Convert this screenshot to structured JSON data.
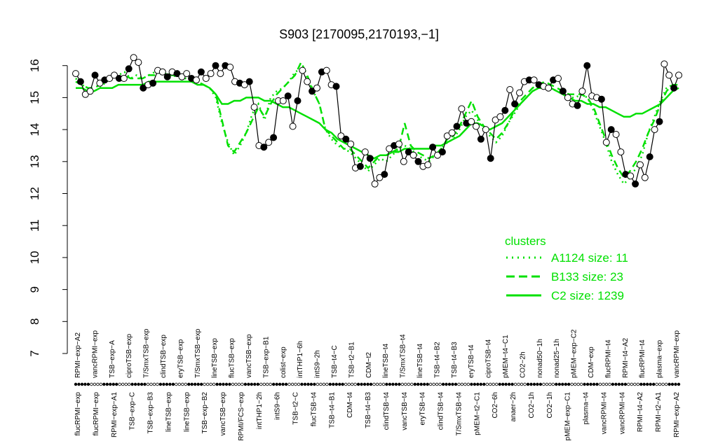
{
  "chart_data": {
    "type": "line",
    "title": "S903 [2170095,2170193,−1]",
    "ylim": [
      7,
      16.3
    ],
    "y_ticks": [
      "7",
      "8",
      "9",
      "10",
      "11",
      "12",
      "13",
      "14",
      "15",
      "16"
    ],
    "top_labels": [
      "RPMI−exp−A2",
      "vancRPMI−exp",
      "TSB−exp−A",
      "ciproTSB−exp",
      "T/SmxTSB−exp",
      "clindTSB−exp",
      "eryTSB−exp",
      "T/SmxTSB−exp",
      "lineTSB−exp",
      "flucTSB−exp",
      "vancTSB−exp",
      "TSB−exp−B1",
      "colist−exp",
      "intTHP1−6h",
      "intS9−2h",
      "TSB−t4−C",
      "TSB−t2−B1",
      "CDM−t2",
      "lineTSB−t4",
      "T/SmxTSB−t4",
      "lineTSB−t4",
      "TSB−t4−B2",
      "TSB−t4−B3",
      "eryTSB−t4",
      "ciproTSB−t4",
      "pMEM−t4−C1",
      "CO2−2h",
      "nonad50−1h",
      "nonad25−1h",
      "pMEM−exp−C2",
      "CDM−exp",
      "flucRPMI−t4",
      "RPMI−t4−A2",
      "flucRPMI−t4",
      "plasma−exp",
      "vancRPMI−exp"
    ],
    "bottom_labels": [
      "flucRPMI−exp",
      "flucRPMI−exp",
      "RPMI−exp−A1",
      "TSB−exp−C",
      "TSB−exp−B3",
      "lineTSB−exp",
      "lineTSB−exp",
      "TSB−exp−B2",
      "vancTSB−exp",
      "RPMI/FCS−exp",
      "intTHP1−2h",
      "intS9−6h",
      "TSB−t2−C",
      "flucTSB−t4",
      "TSB−t4−B1",
      "CDM−t4",
      "TSB−t4−B3",
      "clindTSB−t4",
      "vancTSB−t4",
      "eryTSB−t4",
      "clindTSB−t4",
      "T/SmxTSB−t4",
      "pMEM−t2−C1",
      "CO2−6h",
      "anaer−2h",
      "CO2−1h",
      "CO2−1h",
      "pMEM−exp−C1",
      "plasma−t4",
      "vancRPMI−t4",
      "vancRPMI−t4",
      "RPMI−t4−A2",
      "RPMI−t2−A1",
      "RPMI−exp−A2"
    ],
    "x_count": 193,
    "series": [
      {
        "name": "A1124 size: 11",
        "values": [
          15.6,
          15.4,
          15.3,
          15.2,
          15.3,
          15.5,
          15.6,
          15.7,
          15.8,
          15.6,
          15.7,
          15.6,
          15.7,
          15.8,
          15.9,
          15.7,
          15.8,
          15.6,
          15.7,
          15.6,
          15.5,
          15.4,
          15.3,
          15.0,
          14.2,
          13.6,
          13.2,
          13.5,
          13.9,
          14.5,
          14.8,
          14.3,
          15.0,
          15.2,
          15.3,
          15.5,
          15.8,
          15.9,
          15.6,
          15.2,
          14.8,
          14.0,
          13.7,
          13.5,
          13.4,
          13.3,
          13.1,
          12.9,
          12.7,
          12.9,
          13.1,
          13.0,
          13.2,
          13.4,
          13.5,
          13.4,
          13.2,
          13.1,
          13.0,
          13.2,
          13.4,
          13.6,
          13.7,
          14.0,
          14.4,
          14.6,
          14.3,
          14.0,
          13.8,
          13.6,
          13.8,
          14.2,
          14.5,
          14.8,
          15.0,
          15.2,
          15.3,
          15.4,
          15.3,
          15.2,
          15.1,
          15.0,
          15.0,
          15.1,
          15.0,
          14.6,
          14.1,
          13.6,
          13.0,
          12.6,
          12.3,
          12.5,
          12.8,
          13.2,
          13.9,
          14.4,
          14.9,
          15.3,
          15.4,
          15.4
        ],
        "color": "#00e000"
      },
      {
        "name": "B133 size: 23",
        "values": [
          15.5,
          15.4,
          15.3,
          15.3,
          15.4,
          15.5,
          15.6,
          15.6,
          15.7,
          15.6,
          15.6,
          15.6,
          15.7,
          15.7,
          15.8,
          15.7,
          15.7,
          15.6,
          15.6,
          15.5,
          15.5,
          15.4,
          15.3,
          15.1,
          14.3,
          13.5,
          13.3,
          13.6,
          13.9,
          14.3,
          14.7,
          14.4,
          14.8,
          15.1,
          15.3,
          15.5,
          15.7,
          16.1,
          15.7,
          15.2,
          14.8,
          14.0,
          13.8,
          13.6,
          13.4,
          13.4,
          13.2,
          13.0,
          12.8,
          13.0,
          13.2,
          13.2,
          13.3,
          13.4,
          14.2,
          13.5,
          13.3,
          13.2,
          13.1,
          13.2,
          13.4,
          13.7,
          13.8,
          14.1,
          14.5,
          14.9,
          14.4,
          14.1,
          13.9,
          13.7,
          13.9,
          14.2,
          14.6,
          14.9,
          15.1,
          15.3,
          15.4,
          15.5,
          15.4,
          15.3,
          15.2,
          15.1,
          15.1,
          15.1,
          15.0,
          14.7,
          14.2,
          13.7,
          13.2,
          12.8,
          12.5,
          12.7,
          13.0,
          13.4,
          13.9,
          14.3,
          14.8,
          15.2,
          15.4,
          15.4
        ],
        "color": "#00e000"
      },
      {
        "name": "C2 size: 1239",
        "values": [
          15.3,
          15.3,
          15.2,
          15.2,
          15.3,
          15.3,
          15.3,
          15.4,
          15.4,
          15.4,
          15.4,
          15.4,
          15.5,
          15.5,
          15.5,
          15.5,
          15.5,
          15.5,
          15.5,
          15.5,
          15.4,
          15.4,
          15.3,
          15.1,
          14.8,
          14.8,
          14.9,
          14.9,
          15.0,
          15.0,
          15.0,
          14.9,
          14.9,
          14.8,
          14.7,
          14.7,
          14.6,
          14.5,
          14.4,
          14.3,
          14.2,
          14.0,
          13.9,
          13.7,
          13.6,
          13.5,
          13.4,
          13.3,
          13.2,
          13.1,
          13.2,
          13.2,
          13.3,
          13.3,
          13.4,
          13.4,
          13.4,
          13.4,
          13.4,
          13.5,
          13.5,
          13.6,
          13.7,
          13.8,
          14.0,
          14.2,
          14.2,
          14.1,
          14.0,
          14.1,
          14.2,
          14.4,
          14.6,
          14.8,
          15.0,
          15.2,
          15.3,
          15.3,
          15.3,
          15.2,
          15.1,
          15.0,
          14.9,
          14.9,
          14.8,
          14.8,
          14.7,
          14.7,
          14.6,
          14.5,
          14.4,
          14.4,
          14.5,
          14.5,
          14.6,
          14.7,
          14.8,
          15.0,
          15.2,
          15.3
        ],
        "color": "#00e000"
      },
      {
        "name": "",
        "values": [
          15.75,
          15.5,
          15.1,
          15.2,
          15.7,
          15.45,
          15.55,
          15.6,
          15.7,
          15.6,
          15.6,
          15.9,
          16.25,
          16.1,
          15.3,
          15.4,
          15.45,
          15.85,
          15.8,
          15.65,
          15.8,
          15.75,
          15.65,
          15.75,
          15.6,
          15.55,
          15.8,
          15.6,
          15.75,
          16.0,
          15.75,
          16.0,
          15.95,
          15.5,
          15.45,
          15.4,
          15.5,
          14.7,
          13.5,
          13.45,
          13.6,
          13.75,
          14.9,
          14.9,
          15.05,
          14.1,
          14.9,
          15.85,
          15.5,
          15.2,
          15.3,
          15.8,
          15.85,
          15.4,
          15.35,
          13.8,
          13.7,
          13.55,
          12.8,
          12.85,
          13.3,
          13.1,
          12.3,
          12.5,
          12.6,
          13.4,
          13.5,
          13.55,
          13.0,
          13.3,
          13.2,
          13.0,
          12.85,
          12.9,
          13.45,
          13.2,
          13.3,
          13.8,
          13.9,
          14.1,
          14.65,
          14.2,
          14.25,
          14.1,
          13.7,
          14.0,
          13.1,
          14.3,
          14.4,
          14.6,
          15.25,
          14.8,
          15.15,
          15.5,
          15.55,
          15.55,
          15.4,
          15.35,
          15.3,
          15.55,
          15.6,
          15.2,
          15.0,
          14.8,
          14.75,
          15.2,
          16.0,
          15.05,
          15.0,
          14.95,
          13.6,
          14.0,
          13.85,
          13.3,
          12.6,
          12.55,
          12.3,
          12.9,
          12.5,
          13.15,
          14.0,
          14.25,
          16.05,
          15.7,
          15.3,
          15.7
        ],
        "color": "#000000"
      }
    ],
    "legend": {
      "title": "clusters",
      "position": "right",
      "entries": [
        "A1124 size: 11",
        "B133 size: 23",
        "C2 size: 1239"
      ]
    },
    "grid": false
  }
}
